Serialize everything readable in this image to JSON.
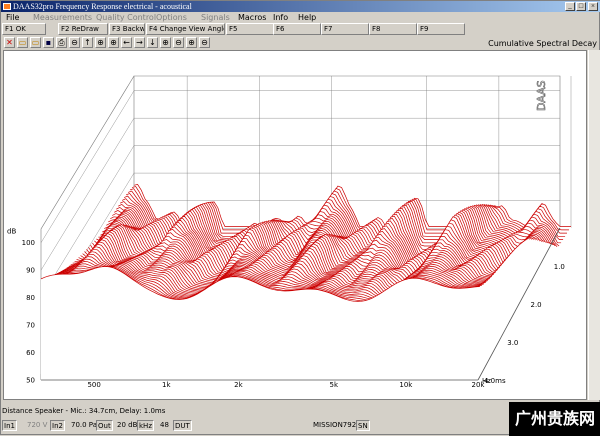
{
  "window": {
    "title": "DAAS32pro Frequency Response electrical - acoustical"
  },
  "menubar": {
    "items": [
      {
        "label": "File",
        "enabled": true
      },
      {
        "label": "Measurements",
        "enabled": false
      },
      {
        "label": "Quality Control",
        "enabled": false
      },
      {
        "label": "Options",
        "enabled": false
      },
      {
        "label": "Signals",
        "enabled": false
      },
      {
        "label": "Macros",
        "enabled": true
      },
      {
        "label": "Info",
        "enabled": true
      },
      {
        "label": "Help",
        "enabled": true
      }
    ]
  },
  "fkeys": [
    "F1 OK",
    "F2 ReDraw",
    "F3 Backward",
    "F4 Change View Angle",
    "F5",
    "F6",
    "F7",
    "F8",
    "F9"
  ],
  "toolbar": {
    "icons": [
      "cross-icon",
      "open-folder-icon",
      "open-folder-icon",
      "save-icon",
      "print-icon",
      "zoom-out-icon",
      "arrow-up-icon",
      "zoom-in-icon",
      "zoom-in-icon",
      "arrow-left-icon",
      "arrow-right-icon",
      "arrow-down-icon",
      "zoom-in-icon",
      "zoom-out-icon",
      "zoom-in-icon",
      "zoom-out-icon"
    ]
  },
  "chart_name": "Cumulative Spectral Decay",
  "chart_data": {
    "type": "waterfall",
    "title": "Cumulative Spectral Decay",
    "logo": "DAAS",
    "line_color": "#cc0000",
    "x_unit": "Hz",
    "x_tick_labels": [
      "500",
      "1k",
      "2k",
      "5k",
      "10k",
      "20k"
    ],
    "x_ticks": [
      500,
      1000,
      2000,
      5000,
      10000,
      20000
    ],
    "xlim": [
      300,
      20000
    ],
    "y_unit": "dB",
    "y_tick_labels": [
      "100",
      "90",
      "80",
      "70",
      "60",
      "50"
    ],
    "y_ticks": [
      100,
      90,
      80,
      70,
      60,
      50
    ],
    "ylim": [
      50,
      105
    ],
    "z_unit": "ms",
    "z_tick_labels": [
      "1.0",
      "2.0",
      "3.0",
      "4.0ms"
    ],
    "z_ticks": [
      1.0,
      2.0,
      3.0,
      4.0
    ],
    "zlim": [
      0,
      4.0
    ],
    "slice_count": 48
  },
  "status": {
    "distance_line": "Distance Speaker - Mic.: 34.7cm, Delay: 1.0ms",
    "fields": [
      {
        "text": "In1",
        "boxed": true,
        "enabled": true
      },
      {
        "text": "720 V",
        "boxed": false,
        "enabled": false
      },
      {
        "text": "In2",
        "boxed": true,
        "enabled": true
      },
      {
        "text": "70.0 Pa",
        "boxed": false,
        "enabled": true
      },
      {
        "text": "Out",
        "boxed": true,
        "enabled": true
      },
      {
        "text": "20 dB",
        "boxed": false,
        "enabled": true
      },
      {
        "text": "kHz",
        "boxed": true,
        "enabled": true
      },
      {
        "text": "48",
        "boxed": false,
        "enabled": true
      },
      {
        "text": "DUT",
        "boxed": true,
        "enabled": true
      },
      {
        "text": "MISSION792",
        "boxed": false,
        "enabled": true
      },
      {
        "text": "SN",
        "boxed": true,
        "enabled": true
      }
    ]
  },
  "watermark": "广州贵族网"
}
